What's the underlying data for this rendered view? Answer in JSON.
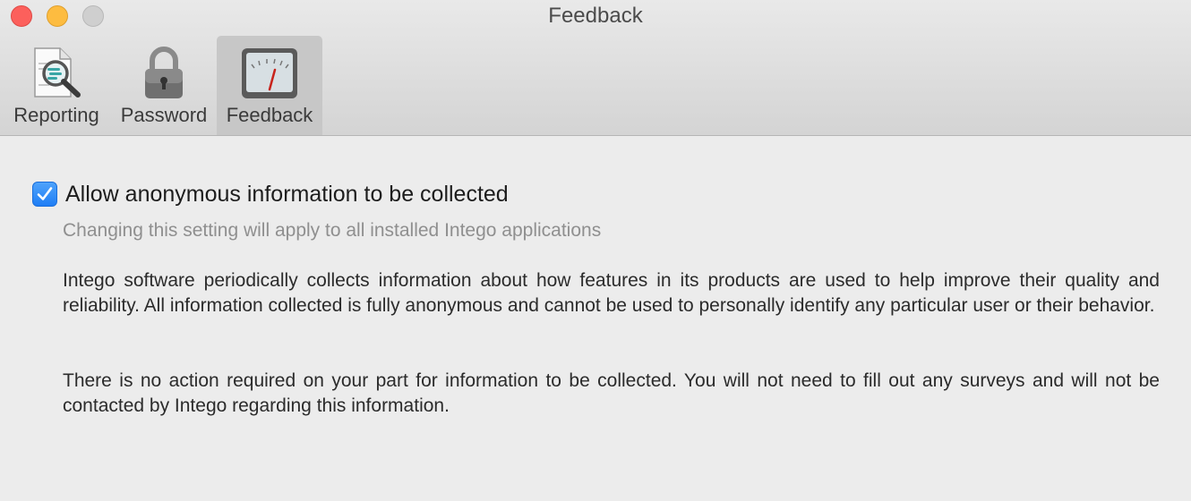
{
  "window": {
    "title": "Feedback"
  },
  "tabs": [
    {
      "label": "Reporting",
      "icon": "report-magnifier-icon",
      "selected": false
    },
    {
      "label": "Password",
      "icon": "padlock-icon",
      "selected": false
    },
    {
      "label": "Feedback",
      "icon": "gauge-meter-icon",
      "selected": true
    }
  ],
  "feedback": {
    "checkbox_label": "Allow anonymous information to be collected",
    "checkbox_checked": true,
    "note": "Changing this setting will apply to all installed Intego applications",
    "paragraph1": "Intego software periodically collects information about how features in its products are used to help improve their quality and reliability. All information collected is fully anonymous and cannot be used to personally identify any particular user or their behavior.",
    "paragraph2": "There is no action required on your part for information to be collected. You will not need to fill out any surveys and will not be contacted by Intego regarding this information."
  },
  "colors": {
    "close": "#fc605c",
    "minimize": "#fdbc40",
    "zoom": "#cfcfcf",
    "accent": "#1f7ef5",
    "selected_tab": "#c7c7c7"
  }
}
